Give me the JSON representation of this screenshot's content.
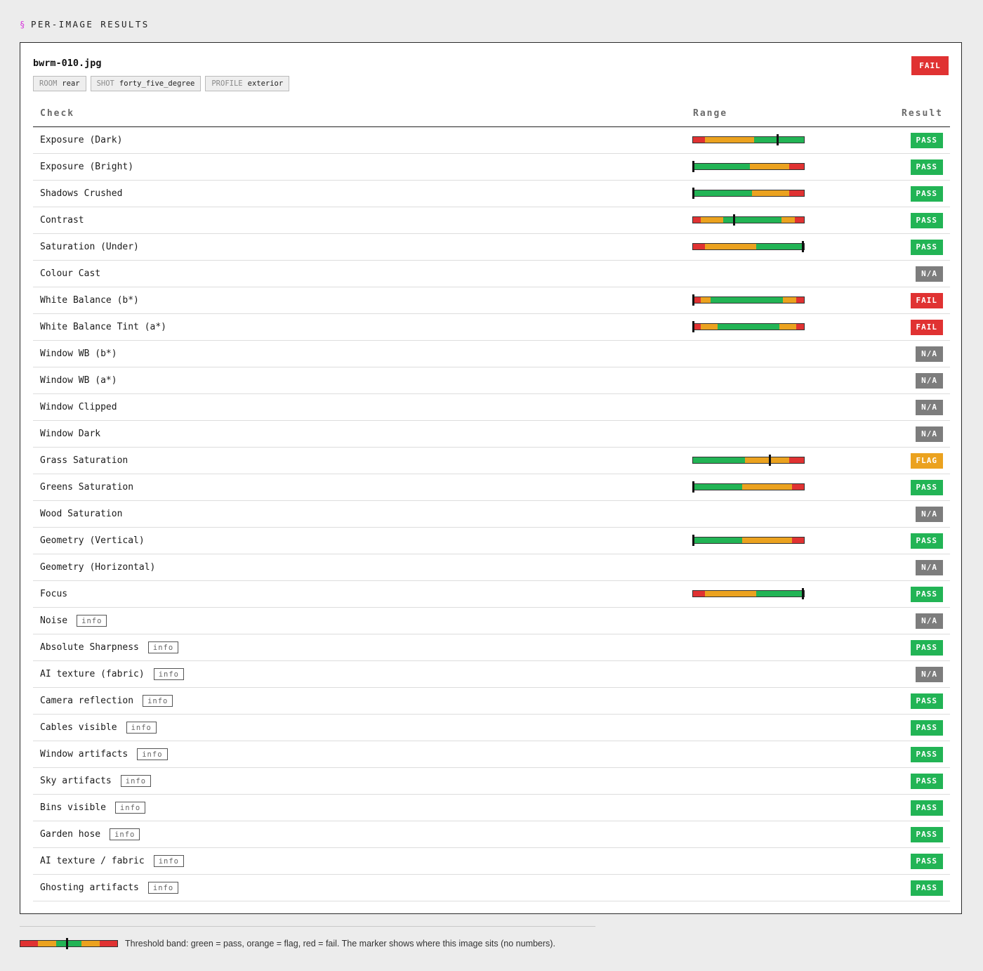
{
  "section": {
    "symbol": "§",
    "title": "PER-IMAGE RESULTS"
  },
  "image": {
    "filename": "bwrm-010.jpg",
    "overall_result": "FAIL",
    "tags": [
      {
        "key": "ROOM",
        "value": "rear"
      },
      {
        "key": "SHOT",
        "value": "forty_five_degree"
      },
      {
        "key": "PROFILE",
        "value": "exterior"
      }
    ]
  },
  "table": {
    "headers": {
      "check": "Check",
      "range": "Range",
      "result": "Result"
    },
    "rows": [
      {
        "check": "Exposure (Dark)",
        "info": null,
        "result": "PASS",
        "band": {
          "segments": [
            [
              "red",
              11
            ],
            [
              "orange",
              44
            ],
            [
              "green",
              20
            ],
            [
              "green",
              2
            ],
            [
              "green",
              23
            ]
          ],
          "marker": 76
        }
      },
      {
        "check": "Exposure (Bright)",
        "info": null,
        "result": "PASS",
        "band": {
          "segments": [
            [
              "green",
              51
            ],
            [
              "orange",
              36
            ],
            [
              "red",
              13
            ]
          ],
          "marker": 0
        }
      },
      {
        "check": "Shadows Crushed",
        "info": null,
        "result": "PASS",
        "band": {
          "segments": [
            [
              "green",
              53
            ],
            [
              "orange",
              34
            ],
            [
              "red",
              13
            ]
          ],
          "marker": 0
        }
      },
      {
        "check": "Contrast",
        "info": null,
        "result": "PASS",
        "band": {
          "segments": [
            [
              "red",
              7
            ],
            [
              "orange",
              20
            ],
            [
              "green",
              9
            ],
            [
              "green",
              3
            ],
            [
              "green",
              41
            ],
            [
              "orange",
              12
            ],
            [
              "red",
              8
            ]
          ],
          "marker": 37
        }
      },
      {
        "check": "Saturation (Under)",
        "info": null,
        "result": "PASS",
        "band": {
          "segments": [
            [
              "red",
              11
            ],
            [
              "orange",
              46
            ],
            [
              "green",
              43
            ]
          ],
          "marker": 99
        }
      },
      {
        "check": "Colour Cast",
        "info": null,
        "result": "N/A",
        "band": null
      },
      {
        "check": "White Balance (b*)",
        "info": null,
        "result": "FAIL",
        "band": {
          "segments": [
            [
              "red",
              7
            ],
            [
              "orange",
              9
            ],
            [
              "green",
              65
            ],
            [
              "orange",
              12
            ],
            [
              "red",
              7
            ]
          ],
          "marker": 0
        }
      },
      {
        "check": "White Balance Tint (a*)",
        "info": null,
        "result": "FAIL",
        "band": {
          "segments": [
            [
              "red",
              7
            ],
            [
              "orange",
              15
            ],
            [
              "green",
              56
            ],
            [
              "orange",
              15
            ],
            [
              "red",
              7
            ]
          ],
          "marker": 0
        }
      },
      {
        "check": "Window WB (b*)",
        "info": null,
        "result": "N/A",
        "band": null
      },
      {
        "check": "Window WB (a*)",
        "info": null,
        "result": "N/A",
        "band": null
      },
      {
        "check": "Window Clipped",
        "info": null,
        "result": "N/A",
        "band": null
      },
      {
        "check": "Window Dark",
        "info": null,
        "result": "N/A",
        "band": null
      },
      {
        "check": "Grass Saturation",
        "info": null,
        "result": "FLAG",
        "band": {
          "segments": [
            [
              "green",
              47
            ],
            [
              "orange",
              40
            ],
            [
              "red",
              13
            ]
          ],
          "marker": 69
        }
      },
      {
        "check": "Greens Saturation",
        "info": null,
        "result": "PASS",
        "band": {
          "segments": [
            [
              "green",
              44
            ],
            [
              "orange",
              45
            ],
            [
              "red",
              11
            ]
          ],
          "marker": 0
        }
      },
      {
        "check": "Wood Saturation",
        "info": null,
        "result": "N/A",
        "band": null
      },
      {
        "check": "Geometry (Vertical)",
        "info": null,
        "result": "PASS",
        "band": {
          "segments": [
            [
              "green",
              44
            ],
            [
              "orange",
              45
            ],
            [
              "red",
              11
            ]
          ],
          "marker": 0
        }
      },
      {
        "check": "Geometry (Horizontal)",
        "info": null,
        "result": "N/A",
        "band": null
      },
      {
        "check": "Focus",
        "info": null,
        "result": "PASS",
        "band": {
          "segments": [
            [
              "red",
              11
            ],
            [
              "orange",
              46
            ],
            [
              "green",
              43
            ]
          ],
          "marker": 99
        }
      },
      {
        "check": "Noise",
        "info": "info",
        "result": "N/A",
        "band": null
      },
      {
        "check": "Absolute Sharpness",
        "info": "info",
        "result": "PASS",
        "band": null
      },
      {
        "check": "AI texture (fabric)",
        "info": "info",
        "result": "N/A",
        "band": null
      },
      {
        "check": "Camera reflection",
        "info": "info",
        "result": "PASS",
        "band": null
      },
      {
        "check": "Cables visible",
        "info": "info",
        "result": "PASS",
        "band": null
      },
      {
        "check": "Window artifacts",
        "info": "info",
        "result": "PASS",
        "band": null
      },
      {
        "check": "Sky artifacts",
        "info": "info",
        "result": "PASS",
        "band": null
      },
      {
        "check": "Bins visible",
        "info": "info",
        "result": "PASS",
        "band": null
      },
      {
        "check": "Garden hose",
        "info": "info",
        "result": "PASS",
        "band": null
      },
      {
        "check": "AI texture / fabric",
        "info": "info",
        "result": "PASS",
        "band": null
      },
      {
        "check": "Ghosting artifacts",
        "info": "info",
        "result": "PASS",
        "band": null
      }
    ]
  },
  "legend": {
    "band": {
      "segments": [
        [
          "red",
          18
        ],
        [
          "orange",
          19
        ],
        [
          "green",
          9
        ],
        [
          "green",
          2
        ],
        [
          "green",
          15
        ],
        [
          "orange",
          19
        ],
        [
          "red",
          18
        ]
      ],
      "marker": 47
    },
    "text": "Threshold band: green = pass, orange = flag, red = fail. The marker shows where this image sits (no numbers)."
  },
  "colors": {
    "green": "#22b455",
    "orange": "#eba21f",
    "red": "#e03232",
    "na": "#7d7d7d",
    "accent": "#d63adb"
  }
}
